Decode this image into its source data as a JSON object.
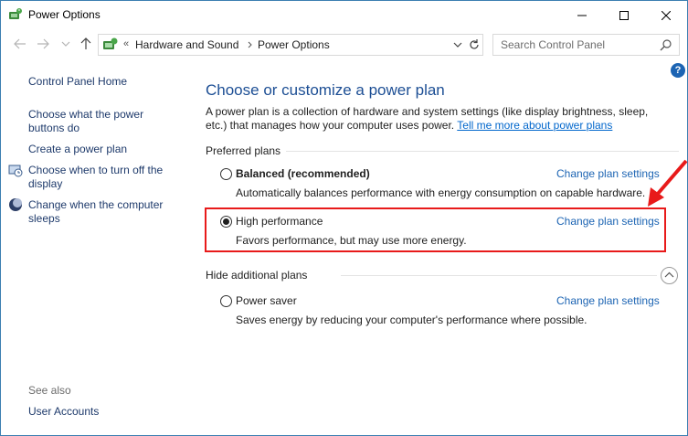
{
  "window": {
    "title": "Power Options"
  },
  "address": {
    "overflow": "«",
    "crumbs": [
      "Hardware and Sound",
      "Power Options"
    ]
  },
  "search": {
    "placeholder": "Search Control Panel"
  },
  "help": {
    "label": "?"
  },
  "sidebar": {
    "home": "Control Panel Home",
    "items": [
      {
        "label": "Choose what the power buttons do",
        "icon": "none"
      },
      {
        "label": "Create a power plan",
        "icon": "none"
      },
      {
        "label": "Choose when to turn off the display",
        "icon": "display-clock-icon"
      },
      {
        "label": "Change when the computer sleeps",
        "icon": "moon-sleep-icon"
      }
    ],
    "see_also": "See also",
    "see_also_items": [
      "User Accounts"
    ]
  },
  "main": {
    "heading": "Choose or customize a power plan",
    "description": "A power plan is a collection of hardware and system settings (like display brightness, sleep, etc.) that manages how your computer uses power.",
    "learn_more": "Tell me more about power plans",
    "preferred_label": "Preferred plans",
    "hide_label": "Hide additional plans",
    "change_link": "Change plan settings",
    "plans": [
      {
        "name": "Balanced (recommended)",
        "description": "Automatically balances performance with energy consumption on capable hardware.",
        "selected": false
      },
      {
        "name": "High performance",
        "description": "Favors performance, but may use more energy.",
        "selected": true
      },
      {
        "name": "Power saver",
        "description": "Saves energy by reducing your computer's performance where possible.",
        "selected": false
      }
    ]
  },
  "colors": {
    "link": "#1c64b3",
    "heading": "#1c4e94",
    "annotation": "#e81a1a"
  }
}
